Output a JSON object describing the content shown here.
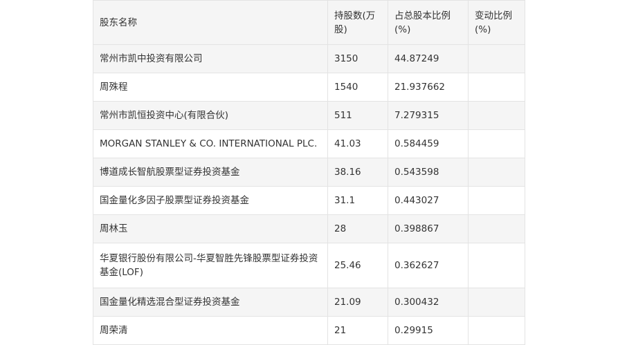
{
  "table": {
    "headers": [
      "股东名称",
      "持股数(万股)",
      "占总股本比例(%)",
      "变动比例(%)"
    ],
    "rows": [
      [
        "常州市凯中投资有限公司",
        "3150",
        "44.87249",
        ""
      ],
      [
        "周殊程",
        "1540",
        "21.937662",
        ""
      ],
      [
        "常州市凯恒投资中心(有限合伙)",
        "511",
        "7.279315",
        ""
      ],
      [
        "MORGAN STANLEY & CO. INTERNATIONAL PLC.",
        "41.03",
        "0.584459",
        ""
      ],
      [
        "博道成长智航股票型证券投资基金",
        "38.16",
        "0.543598",
        ""
      ],
      [
        "国金量化多因子股票型证券投资基金",
        "31.1",
        "0.443027",
        ""
      ],
      [
        "周林玉",
        "28",
        "0.398867",
        ""
      ],
      [
        "华夏银行股份有限公司-华夏智胜先锋股票型证券投资基金(LOF)",
        "25.46",
        "0.362627",
        ""
      ],
      [
        "国金量化精选混合型证券投资基金",
        "21.09",
        "0.300432",
        ""
      ],
      [
        "周荣清",
        "21",
        "0.29915",
        ""
      ]
    ]
  }
}
